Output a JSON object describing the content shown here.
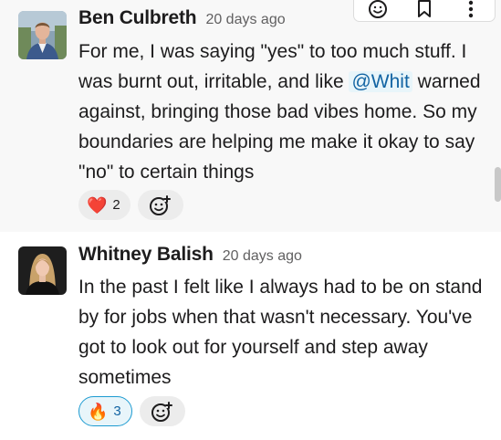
{
  "messages": [
    {
      "author": "Ben Culbreth",
      "time": "20 days ago",
      "body_parts": [
        "For me, I was saying \"yes\" to too much stuff. I was burnt out, irritable, and like ",
        "@Whit",
        " warned against, bringing those bad vibes home. So my boundaries are helping me make it okay to say \"no\" to certain things"
      ],
      "reactions": [
        {
          "emoji": "❤️",
          "icon": "red-heart-icon",
          "count": "2"
        }
      ]
    },
    {
      "author": "Whitney Balish",
      "time": "20 days ago",
      "body": "In the past I felt like I always had to be on stand by for jobs when that wasn't necessary. You've got to look out for yourself and step away sometimes",
      "reactions": [
        {
          "emoji": "🔥",
          "icon": "fire-icon",
          "count": "3"
        }
      ]
    }
  ],
  "toolbar": {
    "icons": [
      "emoji-reaction-icon",
      "bookmark-icon",
      "more-actions-icon"
    ]
  },
  "colors": {
    "mention_bg": "#e8f5fa",
    "mention_text": "#1264a3",
    "active_reaction_border": "#1d9bd1",
    "hover_bg": "#f8f8f8"
  }
}
